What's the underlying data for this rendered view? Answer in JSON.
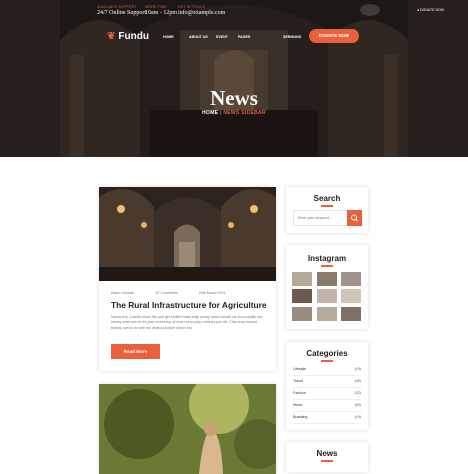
{
  "topbar": {
    "support_label": "AVAILABLE SUPPORT",
    "support_value": "24/7 Online Support",
    "work_label": "WORK TIME",
    "work_value": "10am - 12pm",
    "email_label": "GET IN TOUCH",
    "email_value": "info@example.com",
    "social": "DONATE NOW"
  },
  "brand": {
    "logo": "Fundu"
  },
  "nav": [
    "HOME",
    "ABOUT US",
    "EVENT",
    "PAGES",
    "SERMONS"
  ],
  "donate_button": "DONATE NOW",
  "hero": {
    "title": "News",
    "breadcrumb_home": "HOME",
    "breadcrumb_sep": " | ",
    "breadcrumb_current": "NEWS SIDEBAR"
  },
  "post1": {
    "author": "Adam Hossain",
    "comments": "30 Comments",
    "date": "24th March 2021",
    "title": "The Rural Infrastructure for Agriculture",
    "excerpt": "Nancy boy Charles down the pub get stuffed mate easy peasy brown bread car boot squiffy bro, blimey arse over tit it's your round cup of char horse play chimney pot old. Chip shop bonnet barney owt to do with me what a plonker bloom bro.",
    "button": "Read More"
  },
  "sidebar": {
    "search_title": "Search",
    "search_placeholder": "Enter your keyword...",
    "instagram_title": "Instagram",
    "categories_title": "Categories",
    "categories": [
      {
        "name": "Lifestyle",
        "count": "(19)"
      },
      {
        "name": "Travel",
        "count": "(45)"
      },
      {
        "name": "Fashion",
        "count": "(32)"
      },
      {
        "name": "Music",
        "count": "(29)"
      },
      {
        "name": "Branding",
        "count": "(19)"
      }
    ],
    "news_title": "News"
  },
  "colors": {
    "accent": "#e8603c"
  }
}
